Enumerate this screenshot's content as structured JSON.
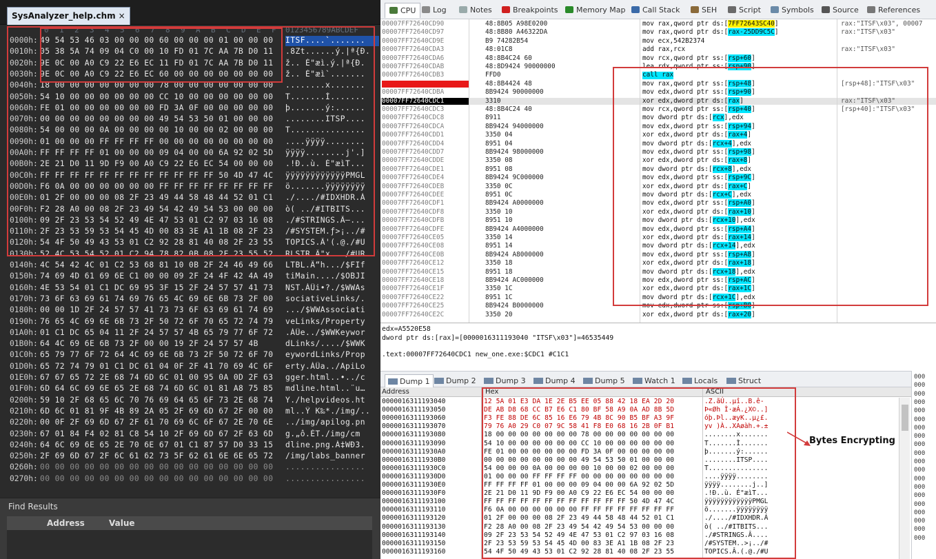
{
  "hexeditor": {
    "file_tab": "SysAnalyzer_help.chm",
    "close_glyph": "×",
    "columns": [
      "0",
      "1",
      "2",
      "3",
      "4",
      "5",
      "6",
      "7",
      "8",
      "9",
      "A",
      "B",
      "C",
      "D",
      "E",
      "F"
    ],
    "ascii_header": "0123456789ABCDEF",
    "rows": [
      {
        "off": "0000h:",
        "hex": "49 54 53 46 03 00 00 00 60 00 00 00 01 00 00 00",
        "asc": "ITSF....`......."
      },
      {
        "off": "0010h:",
        "hex": "05 38 5A 74 09 04 C0 00 10 FD 01 7C AA 7B D0 11",
        "asc": ".8Zt......ý.|ª{Ð."
      },
      {
        "off": "0020h:",
        "hex": "9E 0C 00 A0 C9 22 E6 EC 11 FD 01 7C AA 7B D0 11",
        "asc": "ž.. É\"æì.ý.|ª{Ð."
      },
      {
        "off": "0030h:",
        "hex": "9E 0C 00 A0 C9 22 E6 EC 60 00 00 00 00 00 00 00",
        "asc": "ž.. É\"æì`......."
      },
      {
        "off": "0040h:",
        "hex": "18 00 00 00 00 00 00 00 78 00 00 00 00 00 00 00",
        "asc": "........x......."
      },
      {
        "off": "0050h:",
        "hex": "54 10 00 00 00 00 00 00 CC 10 00 00 00 00 00 00",
        "asc": "T.......Ì......."
      },
      {
        "off": "0060h:",
        "hex": "FE 01 00 00 00 00 00 00 FD 3A 0F 00 00 00 00 00",
        "asc": "þ.......ý:......"
      },
      {
        "off": "0070h:",
        "hex": "00 00 00 00 00 00 00 00 49 54 53 50 01 00 00 00",
        "asc": "........ITSP...."
      },
      {
        "off": "0080h:",
        "hex": "54 00 00 00 0A 00 00 00 00 10 00 00 02 00 00 00",
        "asc": "T..............."
      },
      {
        "off": "0090h:",
        "hex": "01 00 00 00 FF FF FF FF 00 00 00 00 00 00 00 00",
        "asc": "....ÿÿÿÿ........"
      },
      {
        "off": "00A0h:",
        "hex": "FF FF FF FF 01 00 00 00 09 04 00 00 6A 92 02 5D",
        "asc": "ÿÿÿÿ........j'.]"
      },
      {
        "off": "00B0h:",
        "hex": "2E 21 D0 11 9D F9 00 A0 C9 22 E6 EC 54 00 00 00",
        "asc": ".!Ð..ù. É\"æìT..."
      },
      {
        "off": "00C0h:",
        "hex": "FF FF FF FF FF FF FF FF FF FF FF FF 50 4D 47 4C",
        "asc": "ÿÿÿÿÿÿÿÿÿÿÿÿPMGL"
      },
      {
        "off": "00D0h:",
        "hex": "F6 0A 00 00 00 00 00 00 FF FF FF FF FF FF FF FF",
        "asc": "ö.......ÿÿÿÿÿÿÿÿ"
      },
      {
        "off": "00E0h:",
        "hex": "01 2F 00 00 00 08 2F 23 49 44 58 48 44 52 01 C1",
        "asc": "./..../#IDXHDR.Á"
      },
      {
        "off": "00F0h:",
        "hex": "F2 28 A0 00 08 2F 23 49 54 42 49 54 53 00 00 00",
        "asc": "ò( ../#ITBITS..."
      },
      {
        "off": "0100h:",
        "hex": "09 2F 23 53 54 52 49 4E 47 53 01 C2 97 03 16 08",
        "asc": "./#STRINGS.Â—..."
      },
      {
        "off": "0110h:",
        "hex": "2F 23 53 59 53 54 45 4D 00 83 3E A1 1B 08 2F 23",
        "asc": "/#SYSTEM.ƒ>¡../#"
      },
      {
        "off": "0120h:",
        "hex": "54 4F 50 49 43 53 01 C2 92 28 81 40 08 2F 23 55",
        "asc": "TOPICS.Â'(.@./#U"
      },
      {
        "off": "0130h:",
        "hex": "52 4C 53 54 52 01 C2 94 78 82 0B 08 2F 23 55 52",
        "asc": "RLSTR.Â\"x.../#UR"
      },
      {
        "off": "0140h:",
        "hex": "4C 54 42 4C 01 C2 53 68 81 10 0B 2F 24 46 49 66",
        "asc": "LTBL.Â“h.../$FIf"
      },
      {
        "off": "0150h:",
        "hex": "74 69 4D 61 69 6E C1 00 00 09 2F 24 4F 42 4A 49",
        "asc": "tiMain..../$OBJI"
      },
      {
        "off": "0160h:",
        "hex": "4E 53 54 01 C1 DC 69 95 3F 15 2F 24 57 57 41 73",
        "asc": "NST.ÁÜi•?./$WWAs"
      },
      {
        "off": "0170h:",
        "hex": "73 6F 63 69 61 74 69 76 65 4C 69 6E 6B 73 2F 00",
        "asc": "sociativeLinks/."
      },
      {
        "off": "0180h:",
        "hex": "00 00 1D 2F 24 57 57 41 73 73 6F 63 69 61 74 69",
        "asc": ".../$WWAssociati"
      },
      {
        "off": "0190h:",
        "hex": "76 65 4C 69 6E 6B 73 2F 50 72 6F 70 65 72 74 79",
        "asc": "veLinks/Property"
      },
      {
        "off": "01A0h:",
        "hex": "01 C1 DC 65 04 11 2F 24 57 57 4B 65 79 77 6F 72",
        "asc": ".ÁÜe../$WWKeywor"
      },
      {
        "off": "01B0h:",
        "hex": "64 4C 69 6E 6B 73 2F 00 00 19 2F 24 57 57 4B",
        "asc": "dLinks/..../$WWK"
      },
      {
        "off": "01C0h:",
        "hex": "65 79 77 6F 72 64 4C 69 6E 6B 73 2F 50 72 6F 70",
        "asc": "eywordLinks/Prop"
      },
      {
        "off": "01D0h:",
        "hex": "65 72 74 79 01 C1 DC 61 04 0F 2F 41 70 69 4C 6F",
        "asc": "erty.ÁÜa../ApiLo"
      },
      {
        "off": "01E0h:",
        "hex": "67 67 65 72 2E 68 74 6D 6C 01 00 95 0A 0D 2F 63",
        "asc": "gger.html..•../c"
      },
      {
        "off": "01F0h:",
        "hex": "6D 64 6C 69 6E 65 2E 68 74 6D 6C 01 81 A8 75 85",
        "asc": "mdline.html..¨u…"
      },
      {
        "off": "0200h:",
        "hex": "59 10 2F 68 65 6C 70 76 69 64 65 6F 73 2E 68 74",
        "asc": "Y./helpvideos.ht"
      },
      {
        "off": "0210h:",
        "hex": "6D 6C 01 81 9F 4B 89 2A 05 2F 69 6D 67 2F 00 00",
        "asc": "ml..Ÿ K‰*./img/.."
      },
      {
        "off": "0220h:",
        "hex": "00 0F 2F 69 6D 67 2F 61 70 69 6C 6F 67 2E 70 6E",
        "asc": "../img/apilog.pn"
      },
      {
        "off": "0230h:",
        "hex": "67 01 84 F4 02 81 C8 54 10 2F 69 6D 67 2F 63 6D",
        "asc": "g.„ô.ÈT./img/cm"
      },
      {
        "off": "0240h:",
        "hex": "64 6C 69 6E 65 2E 70 6E 67 01 C1 87 57 D0 33 15",
        "asc": "dline.png.Á‡WÐ3."
      },
      {
        "off": "0250h:",
        "hex": "2F 69 6D 67 2F 6C 61 62 73 5F 62 61 6E 6E 65 72",
        "asc": "/img/labs_banner"
      },
      {
        "off": "0260h:",
        "hex": "00 00 00 00 00 00 00 00 00 00 00 00 00 00 00 00",
        "asc": "................"
      },
      {
        "off": "0270h:",
        "hex": "00 00 00 00 00 00 00 00 00 00 00 00 00 00 00 00",
        "asc": "................"
      }
    ],
    "find_results": {
      "title": "Find Results",
      "col_address": "Address",
      "col_value": "Value"
    }
  },
  "debugger": {
    "tabs": [
      {
        "label": "CPU",
        "active": true,
        "color": "#4a7a3a"
      },
      {
        "label": "Log",
        "color": "#8a8a8a"
      },
      {
        "label": "Notes",
        "color": "#9aa"
      },
      {
        "label": "Breakpoints",
        "color": "#d02020"
      },
      {
        "label": "Memory Map",
        "color": "#2a8a2a"
      },
      {
        "label": "Call Stack",
        "color": "#3a6aa8"
      },
      {
        "label": "SEH",
        "color": "#8a6a3a"
      },
      {
        "label": "Script",
        "color": "#6a6a6a"
      },
      {
        "label": "Symbols",
        "color": "#6a8aa8"
      },
      {
        "label": "Source",
        "color": "#555"
      },
      {
        "label": "References",
        "color": "#777"
      }
    ],
    "disasm": [
      {
        "addr": "00007FF72640CD90",
        "bytes": "48:8B05 A98E0200",
        "instr": "mov rax,qword ptr ds:[7FF72643SC40]",
        "comment": "rax:\"ITSF\\x03\", 00007"
      },
      {
        "addr": "00007FF72640CD97",
        "bytes": "48:8B80 A46322DA",
        "instr": "mov rax,qword ptr ds:[rax-25DD9C5C]",
        "comment": "rax:\"ITSF\\x03\""
      },
      {
        "addr": "00007FF72640CD9E",
        "bytes": "B9 74282B54",
        "instr": "mov ecx,542B2374",
        "comment": ""
      },
      {
        "addr": "00007FF72640CDA3",
        "bytes": "48:01C8",
        "instr": "add rax,rcx",
        "comment": "rax:\"ITSF\\x03\""
      },
      {
        "addr": "00007FF72640CDA6",
        "bytes": "48:8B4C24 60",
        "instr": "mov rcx,qword ptr ss:[rsp+60]",
        "comment": ""
      },
      {
        "addr": "00007FF72640CDAB",
        "bytes": "48:8D9424 90000000",
        "instr": "lea rdx,qword ptr ss:[rsp+90]",
        "comment": ""
      },
      {
        "addr": "00007FF72640CDB3",
        "bytes": "FFD0",
        "instr": "call rax",
        "comment": ""
      },
      {
        "addr": "00007FF72640CDB5",
        "bytes": "48:8B4424 48",
        "instr": "mov rax,qword ptr ss:[rsp+48]",
        "comment": "[rsp+48]:\"ITSF\\x03\""
      },
      {
        "addr": "00007FF72640CDBA",
        "bytes": "8B9424 90000000",
        "instr": "mov edx,dword ptr ss:[rsp+90]",
        "comment": ""
      },
      {
        "addr": "00007FF72640CDC1",
        "bytes": "3310",
        "instr": "xor edx,dword ptr ds:[rax]",
        "comment": "rax:\"ITSF\\x03\""
      },
      {
        "addr": "00007FF72640CDC3",
        "bytes": "48:8B4C24 40",
        "instr": "mov rcx,qword ptr ss:[rsp+40]",
        "comment": "[rsp+40]:\"ITSF\\x03\""
      },
      {
        "addr": "00007FF72640CDC8",
        "bytes": "8911",
        "instr": "mov dword ptr ds:[rcx],edx",
        "comment": ""
      },
      {
        "addr": "00007FF72640CDCA",
        "bytes": "8B9424 94000000",
        "instr": "mov edx,dword ptr ss:[rsp+94]",
        "comment": ""
      },
      {
        "addr": "00007FF72640CDD1",
        "bytes": "3350 04",
        "instr": "xor edx,dword ptr ds:[rax+4]",
        "comment": ""
      },
      {
        "addr": "00007FF72640CDD4",
        "bytes": "8951 04",
        "instr": "mov dword ptr ds:[rcx+4],edx",
        "comment": ""
      },
      {
        "addr": "00007FF72640CDD7",
        "bytes": "8B9424 98000000",
        "instr": "mov edx,dword ptr ss:[rsp+98]",
        "comment": ""
      },
      {
        "addr": "00007FF72640CDDE",
        "bytes": "3350 08",
        "instr": "xor edx,dword ptr ds:[rax+8]",
        "comment": ""
      },
      {
        "addr": "00007FF72640CDE1",
        "bytes": "8951 08",
        "instr": "mov dword ptr ds:[rcx+8],edx",
        "comment": ""
      },
      {
        "addr": "00007FF72640CDE4",
        "bytes": "8B9424 9C000000",
        "instr": "mov edx,dword ptr ss:[rsp+9C]",
        "comment": ""
      },
      {
        "addr": "00007FF72640CDEB",
        "bytes": "3350 0C",
        "instr": "xor edx,dword ptr ds:[rax+C]",
        "comment": ""
      },
      {
        "addr": "00007FF72640CDEE",
        "bytes": "8951 0C",
        "instr": "mov dword ptr ds:[rcx+C],edx",
        "comment": ""
      },
      {
        "addr": "00007FF72640CDF1",
        "bytes": "8B9424 A0000000",
        "instr": "mov edx,dword ptr ss:[rsp+A0]",
        "comment": ""
      },
      {
        "addr": "00007FF72640CDF8",
        "bytes": "3350 10",
        "instr": "xor edx,dword ptr ds:[rax+10]",
        "comment": ""
      },
      {
        "addr": "00007FF72640CDFB",
        "bytes": "8951 10",
        "instr": "mov dword ptr ds:[rcx+10],edx",
        "comment": ""
      },
      {
        "addr": "00007FF72640CDFE",
        "bytes": "8B9424 A4000000",
        "instr": "mov edx,dword ptr ss:[rsp+A4]",
        "comment": ""
      },
      {
        "addr": "00007FF72640CE05",
        "bytes": "3350 14",
        "instr": "xor edx,dword ptr ds:[rax+14]",
        "comment": ""
      },
      {
        "addr": "00007FF72640CE08",
        "bytes": "8951 14",
        "instr": "mov dword ptr ds:[rcx+14],edx",
        "comment": ""
      },
      {
        "addr": "00007FF72640CE0B",
        "bytes": "8B9424 A8000000",
        "instr": "mov edx,dword ptr ss:[rsp+A8]",
        "comment": ""
      },
      {
        "addr": "00007FF72640CE12",
        "bytes": "3350 18",
        "instr": "xor edx,dword ptr ds:[rax+18]",
        "comment": ""
      },
      {
        "addr": "00007FF72640CE15",
        "bytes": "8951 18",
        "instr": "mov dword ptr ds:[rcx+18],edx",
        "comment": ""
      },
      {
        "addr": "00007FF72640CE18",
        "bytes": "8B9424 AC000000",
        "instr": "mov edx,dword ptr ss:[rsp+AC]",
        "comment": ""
      },
      {
        "addr": "00007FF72640CE1F",
        "bytes": "3350 1C",
        "instr": "xor edx,dword ptr ds:[rax+1C]",
        "comment": ""
      },
      {
        "addr": "00007FF72640CE22",
        "bytes": "8951 1C",
        "instr": "mov dword ptr ds:[rcx+1C],edx",
        "comment": ""
      },
      {
        "addr": "00007FF72640CE25",
        "bytes": "8B9424 B0000000",
        "instr": "mov edx,dword ptr ss:[rsp+B0]",
        "comment": ""
      },
      {
        "addr": "00007FF72640CE2C",
        "bytes": "3350 20",
        "instr": "xor edx,dword ptr ds:[rax+20]",
        "comment": ""
      }
    ],
    "info": {
      "line1": "edx=A5520E58",
      "line2": "dword ptr ds:[rax]=[0000016311193040 \"ITSF\\x03\"]=46535449",
      "line3": ".text:00007FF72640CDC1 new_one.exe:$CDC1 #C1C1"
    },
    "dump_tabs": [
      {
        "label": "Dump 1",
        "active": true
      },
      {
        "label": "Dump 2"
      },
      {
        "label": "Dump 3"
      },
      {
        "label": "Dump 4"
      },
      {
        "label": "Dump 5"
      },
      {
        "label": "Watch 1",
        "icon": "watch"
      },
      {
        "label": "Locals",
        "icon": "locals"
      },
      {
        "label": "Struct",
        "icon": "struct"
      }
    ],
    "dump_cols": {
      "address": "Address",
      "hex": "Hex",
      "ascii": "ASCII"
    },
    "dump": [
      {
        "addr": "0000016311193040",
        "hex": "12 5A 01 E3 DA 1E 2E B5 EE 05 88 42 18 EA 2D 20",
        "asc": ".Z.ãÚ..µî..B.ê- ",
        "enc": true
      },
      {
        "addr": "0000016311193050",
        "hex": "DE AB D8 68 CC B7 E6 C1 80 BF 58 A9 0A AD 8B 5D",
        "asc": "Þ«Øh Ì·æÁ.¿X©.­.]",
        "enc": true
      },
      {
        "addr": "0000016311193060",
        "hex": "F3 FE 88 DE 6C 85 16 E6 79 4B 8C 90 B5 BF A3 9F",
        "asc": "óþ.Þl..æyK..µ¿£.",
        "enc": true
      },
      {
        "addr": "0000016311193070",
        "hex": "79 76 A0 29 C0 07 9C 58 41 F8 E0 68 16 2B 0F B1",
        "asc": "yv )À..XAøàh.+.±",
        "enc": true
      },
      {
        "addr": "0000016311193080",
        "hex": "18 00 00 00 00 00 00 00 78 00 00 00 00 00 00 00",
        "asc": "........x......."
      },
      {
        "addr": "0000016311193090",
        "hex": "54 10 00 00 00 00 00 00 CC 10 00 00 00 00 00 00",
        "asc": "T.......Ì......."
      },
      {
        "addr": "00000163111930A0",
        "hex": "FE 01 00 00 00 00 00 00 FD 3A 0F 00 00 00 00 00",
        "asc": "þ.......ý:......"
      },
      {
        "addr": "00000163111930B0",
        "hex": "00 00 00 00 00 00 00 00 49 54 53 50 01 00 00 00",
        "asc": "........ITSP...."
      },
      {
        "addr": "00000163111930C0",
        "hex": "54 00 00 00 0A 00 00 00 00 10 00 00 02 00 00 00",
        "asc": "T..............."
      },
      {
        "addr": "00000163111930D0",
        "hex": "01 00 00 00 FF FF FF FF 00 00 00 00 00 00 00 00",
        "asc": "....ÿÿÿÿ........"
      },
      {
        "addr": "00000163111930E0",
        "hex": "FF FF FF FF 01 00 00 00 09 04 00 00 6A 92 02 5D",
        "asc": "ÿÿÿÿ........j..]"
      },
      {
        "addr": "00000163111930F0",
        "hex": "2E 21 D0 11 9D F9 00 A0 C9 22 E6 EC 54 00 00 00",
        "asc": ".!Ð..ù. É\"æìT..."
      },
      {
        "addr": "0000016311193100",
        "hex": "FF FF FF FF FF FF FF FF FF FF FF FF 50 4D 47 4C",
        "asc": "ÿÿÿÿÿÿÿÿÿÿÿÿPMGL"
      },
      {
        "addr": "0000016311193110",
        "hex": "F6 0A 00 00 00 00 00 00 FF FF FF FF FF FF FF FF",
        "asc": "ö.......ÿÿÿÿÿÿÿÿ"
      },
      {
        "addr": "0000016311193120",
        "hex": "01 2F 00 00 00 08 2F 23 49 44 58 48 44 52 01 C1",
        "asc": "./..../#IDXHDR.Á"
      },
      {
        "addr": "0000016311193130",
        "hex": "F2 28 A0 00 08 2F 23 49 54 42 49 54 53 00 00 00",
        "asc": "ò( ../#ITBITS..."
      },
      {
        "addr": "0000016311193140",
        "hex": "09 2F 23 53 54 52 49 4E 47 53 01 C2 97 03 16 08",
        "asc": "./#STRINGS.Â...."
      },
      {
        "addr": "0000016311193150",
        "hex": "2F 23 53 59 53 54 45 4D 00 83 3E A1 1B 08 2F 23",
        "asc": "/#SYSTEM..>¡../#"
      },
      {
        "addr": "0000016311193160",
        "hex": "54 4F 50 49 43 53 01 C2 92 28 81 40 08 2F 23 55",
        "asc": "TOPICS.Â.(.@./#U"
      }
    ],
    "stack_snippet": [
      "000",
      "000",
      "000",
      "000",
      "000",
      "000",
      "000",
      "000",
      "000",
      "000",
      "000",
      "000",
      "000",
      "000",
      "000",
      "000",
      "000",
      "000",
      "000",
      "000"
    ],
    "annotation": "Bytes Encrypting"
  }
}
